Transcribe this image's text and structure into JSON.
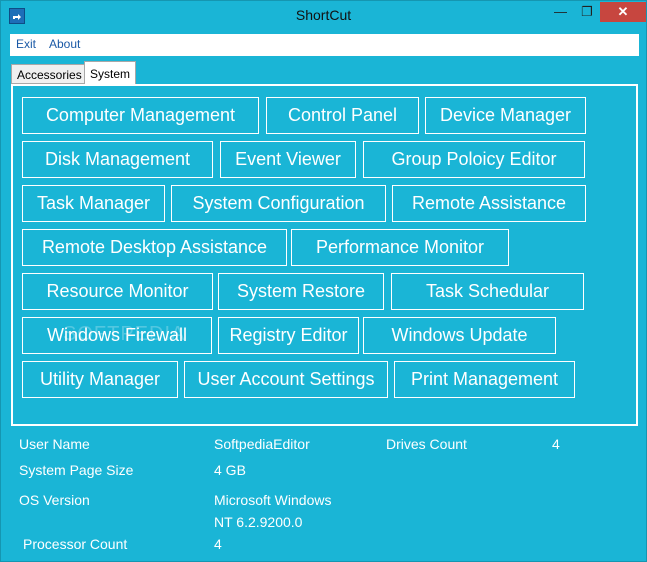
{
  "window": {
    "title": "ShortCut",
    "minimize_glyph": "—",
    "maximize_glyph": "❐",
    "close_glyph": "✕",
    "accent_color": "#1ab5d6"
  },
  "menu": {
    "items": [
      "Exit",
      "About"
    ]
  },
  "tabs": [
    {
      "label": "Accessories",
      "selected": false
    },
    {
      "label": "System",
      "selected": true
    }
  ],
  "buttons": [
    "Computer Management",
    "Control Panel",
    "Device Manager",
    "Disk Management",
    "Event Viewer",
    "Group Poloicy Editor",
    "Task Manager",
    "System Configuration",
    "Remote Assistance",
    "Remote Desktop Assistance",
    "Performance Monitor",
    "Resource Monitor",
    "System Restore",
    "Task Schedular",
    "Windows Firewall",
    "Registry Editor",
    "Windows Update",
    "Utility Manager",
    "User Account Settings",
    "Print Management"
  ],
  "info": {
    "user_name_label": "User Name",
    "user_name_value": "SoftpediaEditor",
    "drives_count_label": "Drives Count",
    "drives_count_value": "4",
    "page_size_label": "System Page Size",
    "page_size_value": "4 GB",
    "os_version_label": "OS Version",
    "os_version_line1": "Microsoft Windows",
    "os_version_line2": "NT 6.2.9200.0",
    "processor_count_label": "Processor Count",
    "processor_count_value": "4"
  },
  "watermark": "SOFTPEDIA"
}
